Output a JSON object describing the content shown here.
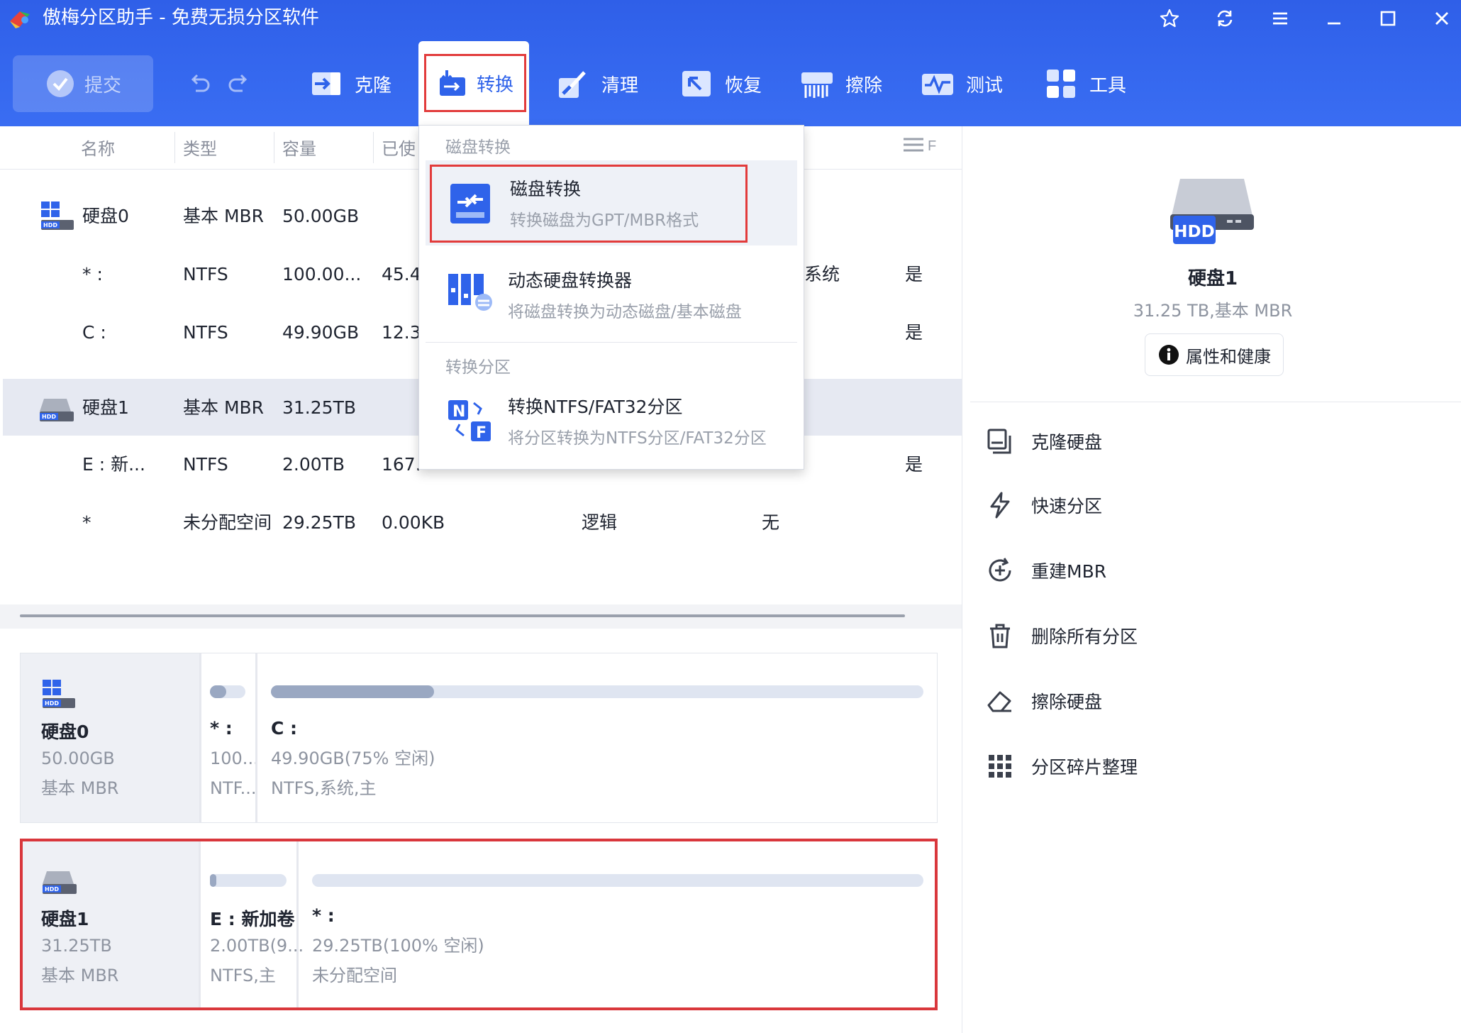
{
  "window": {
    "title": "傲梅分区助手 - 免费无损分区软件"
  },
  "toolbar": {
    "submit": "提交",
    "clone": "克隆",
    "convert": "转换",
    "clean": "清理",
    "restore": "恢复",
    "wipe": "擦除",
    "test": "测试",
    "tools": "工具"
  },
  "columns": [
    "名称",
    "类型",
    "容量",
    "已使"
  ],
  "disk_table": {
    "rows": [
      {
        "name": "硬盘0",
        "type": "基本 MBR",
        "capacity": "50.00GB",
        "used": "",
        "extra": "",
        "flag": ""
      },
      {
        "name": "* :",
        "type": "NTFS",
        "capacity": "100.00...",
        "used": "45.4",
        "extra": "系统",
        "flag": "是"
      },
      {
        "name": "C :",
        "type": "NTFS",
        "capacity": "49.90GB",
        "used": "12.3",
        "extra": "",
        "flag": "是"
      },
      {
        "name": "硬盘1",
        "type": "基本 MBR",
        "capacity": "31.25TB",
        "used": "",
        "extra": "",
        "flag": ""
      },
      {
        "name": "E : 新...",
        "type": "NTFS",
        "capacity": "2.00TB",
        "used": "167.",
        "extra": "",
        "flag": "是"
      },
      {
        "name": "*",
        "type": "未分配空间",
        "capacity": "29.25TB",
        "used": "0.00KB",
        "partition_type": "逻辑",
        "flag": "无"
      }
    ]
  },
  "dropdown": {
    "section1": "磁盘转换",
    "items": [
      {
        "title": "磁盘转换",
        "desc": "转换磁盘为GPT/MBR格式"
      },
      {
        "title": "动态硬盘转换器",
        "desc": "将磁盘转换为动态磁盘/基本磁盘"
      },
      {
        "title": "转换NTFS/FAT32分区",
        "desc": "将分区转换为NTFS分区/FAT32分区"
      }
    ],
    "section2": "转换分区"
  },
  "disk_map": {
    "disk0": {
      "name": "硬盘0",
      "size": "50.00GB",
      "type": "基本 MBR",
      "partitions": [
        {
          "label": "* :",
          "size": "100...",
          "fs": "NTF...",
          "used_fraction": 0.45
        },
        {
          "label": "C :",
          "size": "49.90GB(75% 空闲)",
          "fs": "NTFS,系统,主",
          "used_fraction": 0.25
        }
      ]
    },
    "disk1": {
      "name": "硬盘1",
      "size": "31.25TB",
      "type": "基本 MBR",
      "partitions": [
        {
          "label": "E : 新加卷",
          "size": "2.00TB(9...",
          "fs": "NTFS,主",
          "used_fraction": 0.08
        },
        {
          "label": "* :",
          "size": "29.25TB(100% 空闲)",
          "fs": "未分配空间",
          "used_fraction": 0.0
        }
      ]
    }
  },
  "right_panel": {
    "hdd_badge": "HDD",
    "disk_name": "硬盘1",
    "disk_info": "31.25 TB,基本 MBR",
    "props_button": "属性和健康",
    "actions": [
      "克隆硬盘",
      "快速分区",
      "重建MBR",
      "删除所有分区",
      "擦除硬盘",
      "分区碎片整理"
    ]
  },
  "colors": {
    "accent": "#2f63ea",
    "highlight": "#e23b3b",
    "toolbar": "#3366ee"
  }
}
